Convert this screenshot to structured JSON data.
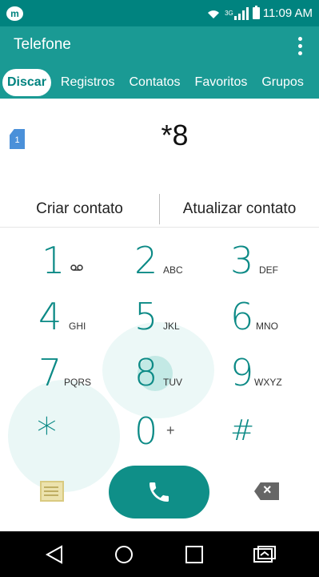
{
  "status_bar": {
    "app_badge": "m",
    "network": "3G",
    "time": "11:09 AM",
    "icons": [
      "wifi-icon",
      "signal-icon",
      "battery-icon"
    ]
  },
  "app_bar": {
    "title": "Telefone",
    "menu_icon": "overflow-menu-icon",
    "tabs": [
      {
        "label": "Discar",
        "active": true
      },
      {
        "label": "Registros",
        "active": false
      },
      {
        "label": "Contatos",
        "active": false
      },
      {
        "label": "Favoritos",
        "active": false
      },
      {
        "label": "Grupos",
        "active": false
      }
    ]
  },
  "dialer": {
    "sim_slot": "1",
    "dialed_number": "*8"
  },
  "actions": {
    "create_contact": "Criar contato",
    "update_contact": "Atualizar contato"
  },
  "keypad": {
    "keys": [
      {
        "digit": "1",
        "letters": ""
      },
      {
        "digit": "2",
        "letters": "ABC"
      },
      {
        "digit": "3",
        "letters": "DEF"
      },
      {
        "digit": "4",
        "letters": "GHI"
      },
      {
        "digit": "5",
        "letters": "JKL"
      },
      {
        "digit": "6",
        "letters": "MNO"
      },
      {
        "digit": "7",
        "letters": "PQRS"
      },
      {
        "digit": "8",
        "letters": "TUV"
      },
      {
        "digit": "9",
        "letters": "WXYZ"
      },
      {
        "digit": "*",
        "letters": ""
      },
      {
        "digit": "0",
        "letters": "+"
      },
      {
        "digit": "#",
        "letters": ""
      }
    ]
  },
  "bottom": {
    "message_icon": "message-icon",
    "call_icon": "phone-icon",
    "delete_icon": "backspace-icon"
  },
  "nav": {
    "icons": [
      "back-icon",
      "home-icon",
      "recents-icon",
      "switch-sim-icon"
    ]
  },
  "colors": {
    "accent": "#00837f",
    "app_bar": "#1a9a94",
    "key_digit": "#0c8a86"
  }
}
